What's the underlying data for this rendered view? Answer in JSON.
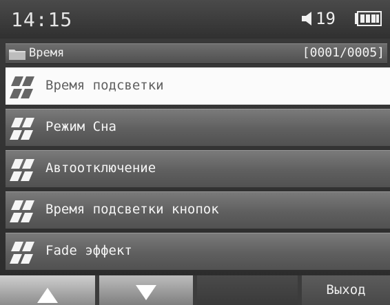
{
  "status_bar": {
    "time": "14:15",
    "volume": "19",
    "battery_level": 0.8
  },
  "header": {
    "title": "Время",
    "counter": "[0001/0005]"
  },
  "menu": {
    "selected_index": 0,
    "items": [
      {
        "label": "Время подсветки"
      },
      {
        "label": "Режим Сна"
      },
      {
        "label": "Автоотключение"
      },
      {
        "label": "Время подсветки кнопок"
      },
      {
        "label": "Fade эффект"
      }
    ]
  },
  "softkeys": {
    "up_icon": "arrow-up-icon",
    "down_icon": "arrow-down-icon",
    "exit_label": "Выход"
  },
  "colors": {
    "selected_background": "#fbfbfb",
    "item_background": "#5f5f5f",
    "text_light": "#f5f5f5"
  }
}
